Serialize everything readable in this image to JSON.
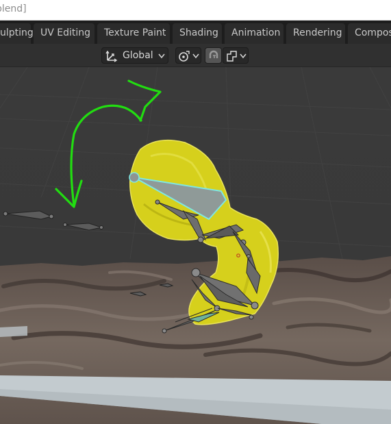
{
  "window": {
    "title_fragment": "blend]"
  },
  "workspace_tabs": [
    {
      "label": "ulpting"
    },
    {
      "label": "UV Editing"
    },
    {
      "label": "Texture Paint"
    },
    {
      "label": "Shading"
    },
    {
      "label": "Animation"
    },
    {
      "label": "Rendering"
    },
    {
      "label": "Compos"
    }
  ],
  "header": {
    "transform_orientation": {
      "value": "Global",
      "icon": "transform-orientation-icon"
    },
    "pivot_icon": "pivot-point-icon",
    "snap_icon": "snap-magnet-icon",
    "snap_target_icon": "snap-target-icon"
  },
  "colors": {
    "viewport_bg": "#393939",
    "selected_mesh": "#d7d11f",
    "active_bone": "#7ee7e3",
    "annotation": "#22dd11",
    "ground": "#6e625a",
    "floor_plane": "#c3cbcf"
  }
}
